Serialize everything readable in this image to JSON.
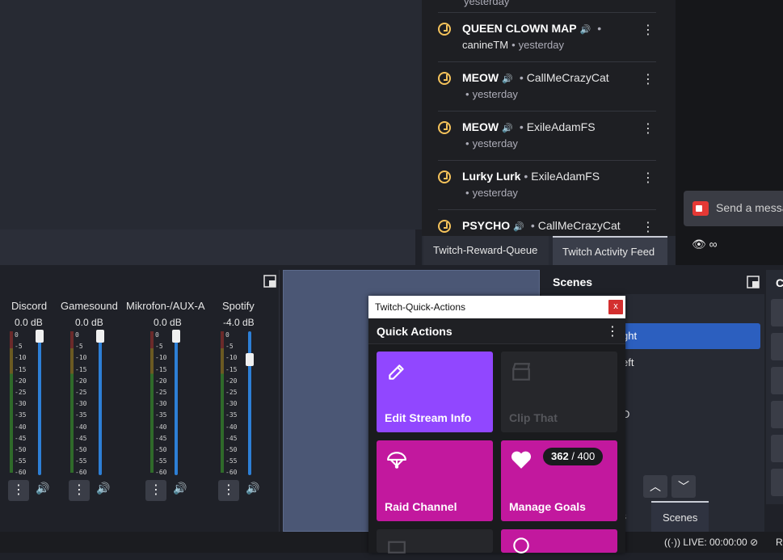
{
  "feed": {
    "items": [
      {
        "title": "QUEEN CLOWN MAP",
        "user": "canineTM",
        "time": "yesterday",
        "has_sound": true
      },
      {
        "title": "MEOW",
        "user": "CallMeCrazyCat",
        "time": "yesterday",
        "has_sound": true
      },
      {
        "title": "MEOW",
        "user": "ExileAdamFS",
        "time": "yesterday",
        "has_sound": true
      },
      {
        "title": "Lurky Lurk",
        "user": "ExileAdamFS",
        "time": "yesterday",
        "has_sound": false
      },
      {
        "title": "PSYCHO",
        "user": "CallMeCrazyCat",
        "time": "",
        "has_sound": true
      }
    ],
    "truncated_top": "yesterday"
  },
  "dock_tabs": {
    "reward_queue": "Twitch-Reward-Queue",
    "activity_feed": "Twitch Activity Feed"
  },
  "chat": {
    "placeholder": "Send a messa",
    "viewer_count": "∞"
  },
  "mixer": {
    "scale": "0\n-5\n-10\n-15\n-20\n-25\n-30\n-35\n-40\n-45\n-50\n-55\n-60",
    "channels": [
      {
        "name": "Discord",
        "db": "0.0 dB",
        "level": 1.0
      },
      {
        "name": "Gamesound",
        "db": "0.0 dB",
        "level": 1.0
      },
      {
        "name": "Mikrofon-/AUX-A",
        "db": "0.0 dB",
        "level": 1.0
      },
      {
        "name": "Spotify",
        "db": "-4.0 dB",
        "level": 0.82
      }
    ]
  },
  "scenes": {
    "header": "Scenes",
    "items": [
      "ght",
      "eft",
      "D"
    ],
    "tabs": {
      "sources": "ons",
      "scenes": "Scenes"
    }
  },
  "far_right": {
    "header": "C"
  },
  "status": {
    "live": "LIVE: 00:00:00",
    "rec": "R"
  },
  "quick_actions": {
    "window_title": "Twitch-Quick-Actions",
    "close": "x",
    "header": "Quick Actions",
    "tiles": {
      "edit": "Edit Stream Info",
      "clip": "Clip That",
      "raid": "Raid Channel",
      "goals": "Manage Goals"
    },
    "goal_current": "362",
    "goal_total": "/ 400"
  },
  "colors": {
    "accent_purple": "#9147ff",
    "accent_magenta": "#c2189e",
    "clock_yellow": "#f5c35b",
    "scene_selected": "#2c5fbf"
  }
}
